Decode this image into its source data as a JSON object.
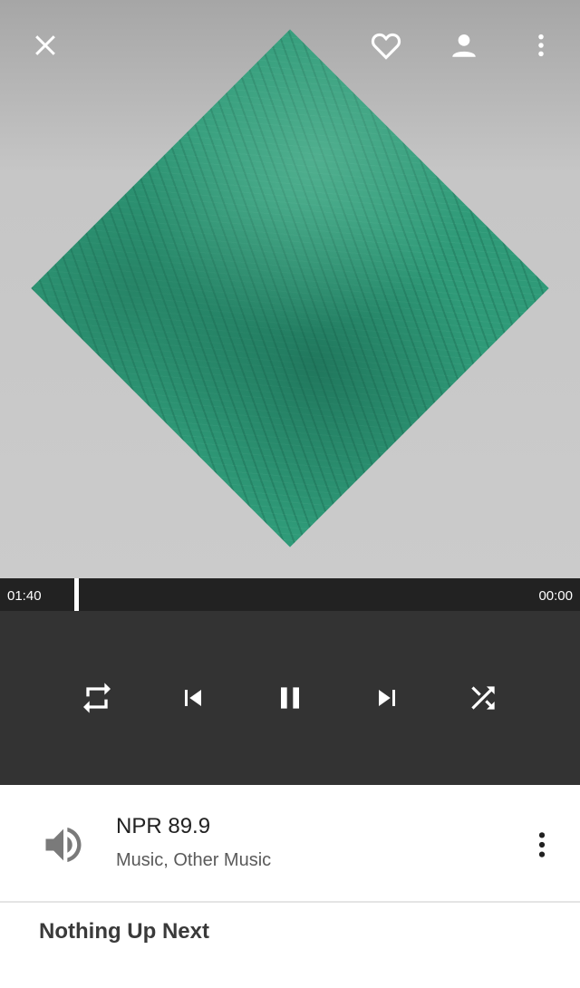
{
  "player": {
    "elapsed": "01:40",
    "remaining": "00:00",
    "progress": 0.128
  },
  "station": {
    "name": "NPR 89.9",
    "genre": "Music, Other Music"
  },
  "queue": {
    "up_next_label": "Nothing Up Next"
  },
  "icons": {
    "close": "close-icon",
    "favorite": "heart-outline-icon",
    "account": "person-icon",
    "overflow": "more-vert-icon",
    "repeat": "repeat-icon",
    "previous": "skip-previous-icon",
    "pause": "pause-icon",
    "next": "skip-next-icon",
    "shuffle": "shuffle-icon",
    "volume": "volume-icon",
    "station_menu": "more-vert-icon"
  },
  "colors": {
    "art_background": "#c9c9c9",
    "artwork_green": "#2f9a78",
    "progress_track": "#222222",
    "controls_background": "#333333"
  }
}
